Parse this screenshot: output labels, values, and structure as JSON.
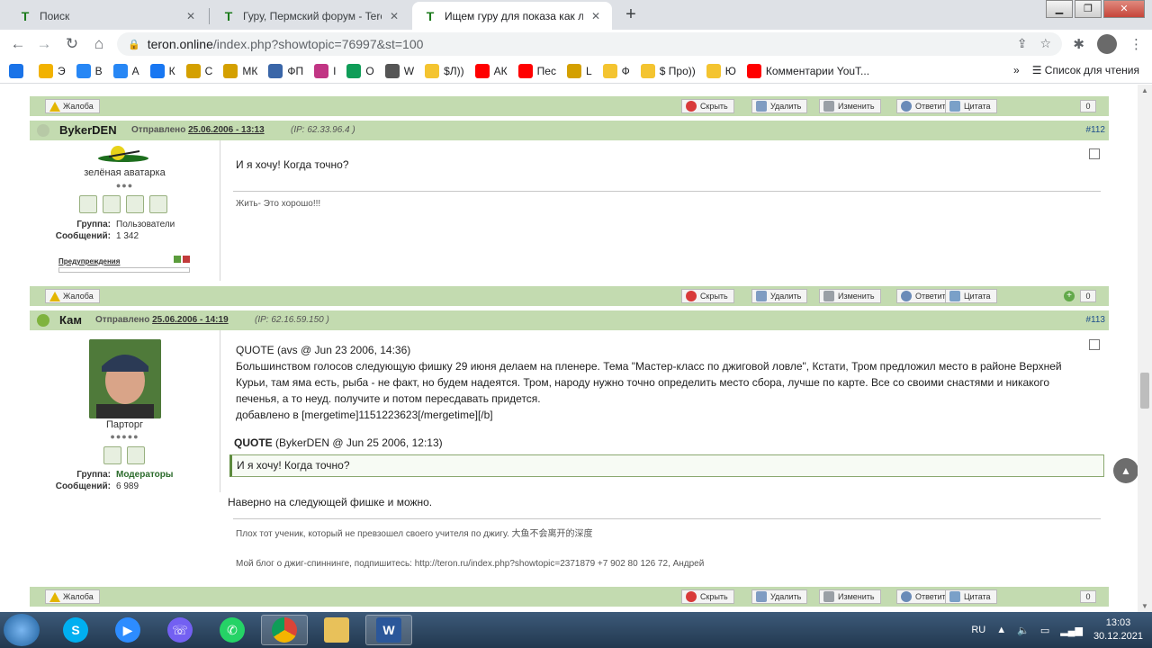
{
  "browser": {
    "tabs": [
      {
        "title": "Поиск",
        "icon": "teron-icon"
      },
      {
        "title": "Гуру, Пермский форум - Teron.o",
        "icon": "teron-icon"
      },
      {
        "title": "Ищем гуру для показа как лов",
        "icon": "teron-icon"
      }
    ],
    "url_host": "teron.online",
    "url_path": "/index.php?showtopic=76997&st=100",
    "bookmarks": [
      {
        "label": "",
        "color": "#1a73e8"
      },
      {
        "label": "Э",
        "color": "#f2b200"
      },
      {
        "label": "В",
        "color": "#2787f5"
      },
      {
        "label": "А",
        "color": "#2787f5"
      },
      {
        "label": "К",
        "color": "#1877f2"
      },
      {
        "label": "С",
        "color": "#d4a000"
      },
      {
        "label": "МК",
        "color": "#d4a000"
      },
      {
        "label": "ФП",
        "color": "#3a66a8"
      },
      {
        "label": "I",
        "color": "#c13584"
      },
      {
        "label": "О",
        "color": "#0f9d58"
      },
      {
        "label": "W",
        "color": "#555555"
      },
      {
        "label": "$Л))",
        "color": "#f4c430"
      },
      {
        "label": "АК",
        "color": "#ff0000"
      },
      {
        "label": "Пес",
        "color": "#ff0000"
      },
      {
        "label": "L",
        "color": "#d4a000"
      },
      {
        "label": "Ф",
        "color": "#f4c430"
      },
      {
        "label": "$ Про))",
        "color": "#f4c430"
      },
      {
        "label": "Ю",
        "color": "#f4c430"
      },
      {
        "label": "Комментарии YouT...",
        "color": "#ff0000"
      }
    ],
    "bookmarks_more": "»",
    "reading_list": "Список для чтения"
  },
  "actions": {
    "complain": "Жалоба",
    "hide": "Скрыть",
    "delete": "Удалить",
    "edit": "Изменить",
    "reply": "Ответить",
    "quote": "Цитата",
    "count": "0"
  },
  "posts": [
    {
      "username": "BykerDEN",
      "posted_label": "Отправлено",
      "date": "25.06.2006 - 13:13",
      "ip": "(IP: 62.33.96.4 )",
      "number": "#112",
      "member_title": "зелёная аватарка",
      "group_label": "Группа:",
      "group": "Пользователи",
      "posts_label": "Сообщений:",
      "posts_count": "1 342",
      "warnings_label": "Предупреждения",
      "message": "И я хочу! Когда точно?",
      "signature": "Жить- Это хорошо!!!"
    },
    {
      "username": "Кам",
      "posted_label": "Отправлено",
      "date": "25.06.2006 - 14:19",
      "ip": "(IP: 62.16.59.150 )",
      "number": "#113",
      "member_title": "Парторг",
      "group_label": "Группа:",
      "group": "Модераторы",
      "posts_label": "Сообщений:",
      "posts_count": "6 989",
      "quote1_header": "QUOTE (avs @ Jun 23 2006, 14:36)",
      "quote1_lines": [
        "Большинством голосов следующую фишку 29 июня делаем на пленере. Тема \"Мастер-класс по джиговой ловле\", Кстати, Тром предложил место в районе Верхней",
        "Курьи, там яма есть, рыба - не факт, но будем надеятся. Тром, народу нужно точно определить место сбора, лучше по карте. Все со своими снастями и никакого",
        "печенья, а то неуд. получите и потом пересдавать придется.",
        "добавлено в [mergetime]1151223623[/mergetime][/b]"
      ],
      "quote2_author": "QUOTE",
      "quote2_meta": "(BykerDEN @ Jun 25 2006, 12:13)",
      "quote2_text": "И я хочу! Когда точно?",
      "message": "Наверно на следующей фишке и можно.",
      "signature1": "Плох тот ученик, который не превзошел своего учителя по джигу. 大鱼不会离开的深度",
      "signature2": "Мой блог о джиг-спиннинге, подпишитесь: http://teron.ru/index.php?showtopic=2371879 +7 902 80 126 72, Андрей"
    }
  ],
  "taskbar": {
    "lang": "RU",
    "time": "13:03",
    "date": "30.12.2021"
  }
}
